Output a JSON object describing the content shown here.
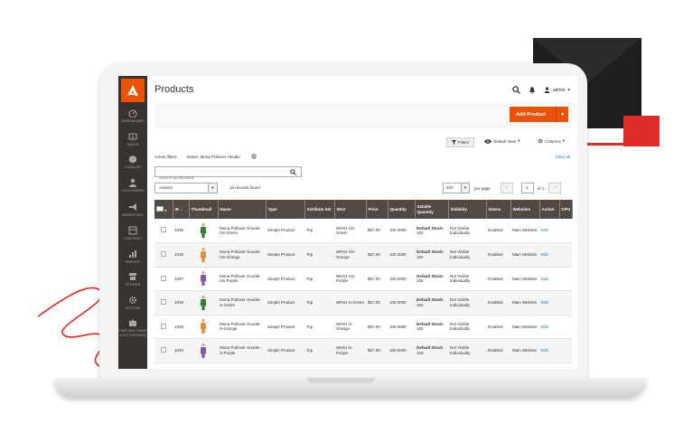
{
  "colors": {
    "accent": "#eb5202",
    "sidebar": "#373330",
    "header_row": "#514943",
    "link": "#007bdb",
    "brand_red": "#e02b27"
  },
  "sidebar": {
    "logo": "adobe-logo",
    "items": [
      {
        "label": "DASHBOARD",
        "icon": "dashboard-icon"
      },
      {
        "label": "SALES",
        "icon": "dollar-icon"
      },
      {
        "label": "CATALOG",
        "icon": "cube-icon"
      },
      {
        "label": "CUSTOMERS",
        "icon": "person-icon"
      },
      {
        "label": "MARKETING",
        "icon": "megaphone-icon"
      },
      {
        "label": "CONTENT",
        "icon": "layout-icon"
      },
      {
        "label": "REPORT",
        "icon": "bar-chart-icon"
      },
      {
        "label": "STORES",
        "icon": "store-icon"
      },
      {
        "label": "SYSTEM",
        "icon": "gear-icon"
      },
      {
        "label": "FIND PARTNERS & EXTENSIONS",
        "icon": "puzzle-icon"
      }
    ]
  },
  "header": {
    "title": "Products",
    "user": "admin"
  },
  "toolbar": {
    "add_product": "Add Product",
    "filters": "Filters",
    "view": "Default View",
    "columns": "Columns"
  },
  "active_filters": {
    "label": "Active filters:",
    "value": "Name: Mona Pullover Hoodie",
    "clear": "Clear all"
  },
  "search": {
    "placeholder": "Search by keyword"
  },
  "actions": {
    "label": "Actions"
  },
  "records": "16 records found",
  "pager": {
    "per_page_value": "200",
    "per_page_label": "per page",
    "prev": "<",
    "next": ">",
    "page": "1",
    "of": "of 1"
  },
  "columns": [
    "ID",
    "Thumbnail",
    "Name",
    "Type",
    "Attribute Set",
    "SKU",
    "Price",
    "Quantity",
    "Salable Quantity",
    "Visibility",
    "Status",
    "Websites",
    "Action",
    "CPU"
  ],
  "rows": [
    {
      "id": "1035",
      "color": "#2e7d32",
      "name": "Mona Pullover Hoodie-XS-Green",
      "type": "Simple Product",
      "attr": "Top",
      "sku": "WH01-XS-Green",
      "price": "$57.00",
      "qty": "100.0000",
      "salable_label": "Default Stock:",
      "salable_value": "100",
      "visibility": "Not Visible Individually",
      "status": "Enabled",
      "websites": "Main Website",
      "action": "Edit"
    },
    {
      "id": "1036",
      "color": "#e0903c",
      "name": "Mona Pullover Hoodie-XS-Orange",
      "type": "Simple Product",
      "attr": "Top",
      "sku": "WH01-XS-Orange",
      "price": "$57.00",
      "qty": "100.0000",
      "salable_label": "Default Stock:",
      "salable_value": "100",
      "visibility": "Not Visible Individually",
      "status": "Enabled",
      "websites": "Main Website",
      "action": "Edit"
    },
    {
      "id": "1037",
      "color": "#7e5aa8",
      "name": "Mona Pullover Hoodie-XS-Purple",
      "type": "Simple Product",
      "attr": "Top",
      "sku": "WH01-XS-Purple",
      "price": "$57.00",
      "qty": "100.0000",
      "salable_label": "Default Stock:",
      "salable_value": "100",
      "visibility": "Not Visible Individually",
      "status": "Enabled",
      "websites": "Main Website",
      "action": "Edit"
    },
    {
      "id": "1038",
      "color": "#2e7d32",
      "name": "Mona Pullover Hoodie-S-Green",
      "type": "Simple Product",
      "attr": "Top",
      "sku": "WH01-S-Green",
      "price": "$57.00",
      "qty": "100.0000",
      "salable_label": "Default Stock:",
      "salable_value": "100",
      "visibility": "Not Visible Individually",
      "status": "Enabled",
      "websites": "Main Website",
      "action": "Edit"
    },
    {
      "id": "1039",
      "color": "#e0903c",
      "name": "Mona Pullover Hoodie-S-Orange",
      "type": "Simple Product",
      "attr": "Top",
      "sku": "WH01-S-Orange",
      "price": "$57.00",
      "qty": "100.0000",
      "salable_label": "Default Stock:",
      "salable_value": "100",
      "visibility": "Not Visible Individually",
      "status": "Enabled",
      "websites": "Main Website",
      "action": "Edit"
    },
    {
      "id": "1040",
      "color": "#7e5aa8",
      "name": "Mona Pullover Hoodie-S-Purple",
      "type": "Simple Product",
      "attr": "Top",
      "sku": "WH01-S-Purple",
      "price": "$57.00",
      "qty": "100.0000",
      "salable_label": "Default Stock:",
      "salable_value": "100",
      "visibility": "Not Visible Individually",
      "status": "Enabled",
      "websites": "Main Website",
      "action": "Edit"
    }
  ]
}
